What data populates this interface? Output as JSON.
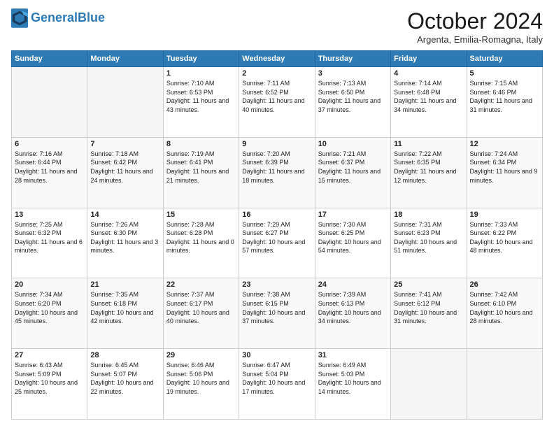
{
  "header": {
    "logo_general": "General",
    "logo_blue": "Blue",
    "month_title": "October 2024",
    "location": "Argenta, Emilia-Romagna, Italy"
  },
  "days_of_week": [
    "Sunday",
    "Monday",
    "Tuesday",
    "Wednesday",
    "Thursday",
    "Friday",
    "Saturday"
  ],
  "weeks": [
    {
      "row_class": "row-1",
      "days": [
        {
          "num": "",
          "empty": true
        },
        {
          "num": "",
          "empty": true
        },
        {
          "num": "1",
          "sunrise": "7:10 AM",
          "sunset": "6:53 PM",
          "daylight": "11 hours and 43 minutes."
        },
        {
          "num": "2",
          "sunrise": "7:11 AM",
          "sunset": "6:52 PM",
          "daylight": "11 hours and 40 minutes."
        },
        {
          "num": "3",
          "sunrise": "7:13 AM",
          "sunset": "6:50 PM",
          "daylight": "11 hours and 37 minutes."
        },
        {
          "num": "4",
          "sunrise": "7:14 AM",
          "sunset": "6:48 PM",
          "daylight": "11 hours and 34 minutes."
        },
        {
          "num": "5",
          "sunrise": "7:15 AM",
          "sunset": "6:46 PM",
          "daylight": "11 hours and 31 minutes."
        }
      ]
    },
    {
      "row_class": "row-2",
      "days": [
        {
          "num": "6",
          "sunrise": "7:16 AM",
          "sunset": "6:44 PM",
          "daylight": "11 hours and 28 minutes."
        },
        {
          "num": "7",
          "sunrise": "7:18 AM",
          "sunset": "6:42 PM",
          "daylight": "11 hours and 24 minutes."
        },
        {
          "num": "8",
          "sunrise": "7:19 AM",
          "sunset": "6:41 PM",
          "daylight": "11 hours and 21 minutes."
        },
        {
          "num": "9",
          "sunrise": "7:20 AM",
          "sunset": "6:39 PM",
          "daylight": "11 hours and 18 minutes."
        },
        {
          "num": "10",
          "sunrise": "7:21 AM",
          "sunset": "6:37 PM",
          "daylight": "11 hours and 15 minutes."
        },
        {
          "num": "11",
          "sunrise": "7:22 AM",
          "sunset": "6:35 PM",
          "daylight": "11 hours and 12 minutes."
        },
        {
          "num": "12",
          "sunrise": "7:24 AM",
          "sunset": "6:34 PM",
          "daylight": "11 hours and 9 minutes."
        }
      ]
    },
    {
      "row_class": "row-3",
      "days": [
        {
          "num": "13",
          "sunrise": "7:25 AM",
          "sunset": "6:32 PM",
          "daylight": "11 hours and 6 minutes."
        },
        {
          "num": "14",
          "sunrise": "7:26 AM",
          "sunset": "6:30 PM",
          "daylight": "11 hours and 3 minutes."
        },
        {
          "num": "15",
          "sunrise": "7:28 AM",
          "sunset": "6:28 PM",
          "daylight": "11 hours and 0 minutes."
        },
        {
          "num": "16",
          "sunrise": "7:29 AM",
          "sunset": "6:27 PM",
          "daylight": "10 hours and 57 minutes."
        },
        {
          "num": "17",
          "sunrise": "7:30 AM",
          "sunset": "6:25 PM",
          "daylight": "10 hours and 54 minutes."
        },
        {
          "num": "18",
          "sunrise": "7:31 AM",
          "sunset": "6:23 PM",
          "daylight": "10 hours and 51 minutes."
        },
        {
          "num": "19",
          "sunrise": "7:33 AM",
          "sunset": "6:22 PM",
          "daylight": "10 hours and 48 minutes."
        }
      ]
    },
    {
      "row_class": "row-4",
      "days": [
        {
          "num": "20",
          "sunrise": "7:34 AM",
          "sunset": "6:20 PM",
          "daylight": "10 hours and 45 minutes."
        },
        {
          "num": "21",
          "sunrise": "7:35 AM",
          "sunset": "6:18 PM",
          "daylight": "10 hours and 42 minutes."
        },
        {
          "num": "22",
          "sunrise": "7:37 AM",
          "sunset": "6:17 PM",
          "daylight": "10 hours and 40 minutes."
        },
        {
          "num": "23",
          "sunrise": "7:38 AM",
          "sunset": "6:15 PM",
          "daylight": "10 hours and 37 minutes."
        },
        {
          "num": "24",
          "sunrise": "7:39 AM",
          "sunset": "6:13 PM",
          "daylight": "10 hours and 34 minutes."
        },
        {
          "num": "25",
          "sunrise": "7:41 AM",
          "sunset": "6:12 PM",
          "daylight": "10 hours and 31 minutes."
        },
        {
          "num": "26",
          "sunrise": "7:42 AM",
          "sunset": "6:10 PM",
          "daylight": "10 hours and 28 minutes."
        }
      ]
    },
    {
      "row_class": "row-5",
      "days": [
        {
          "num": "27",
          "sunrise": "6:43 AM",
          "sunset": "5:09 PM",
          "daylight": "10 hours and 25 minutes."
        },
        {
          "num": "28",
          "sunrise": "6:45 AM",
          "sunset": "5:07 PM",
          "daylight": "10 hours and 22 minutes."
        },
        {
          "num": "29",
          "sunrise": "6:46 AM",
          "sunset": "5:06 PM",
          "daylight": "10 hours and 19 minutes."
        },
        {
          "num": "30",
          "sunrise": "6:47 AM",
          "sunset": "5:04 PM",
          "daylight": "10 hours and 17 minutes."
        },
        {
          "num": "31",
          "sunrise": "6:49 AM",
          "sunset": "5:03 PM",
          "daylight": "10 hours and 14 minutes."
        },
        {
          "num": "",
          "empty": true
        },
        {
          "num": "",
          "empty": true
        }
      ]
    }
  ],
  "labels": {
    "sunrise": "Sunrise: ",
    "sunset": "Sunset: ",
    "daylight": "Daylight: "
  }
}
